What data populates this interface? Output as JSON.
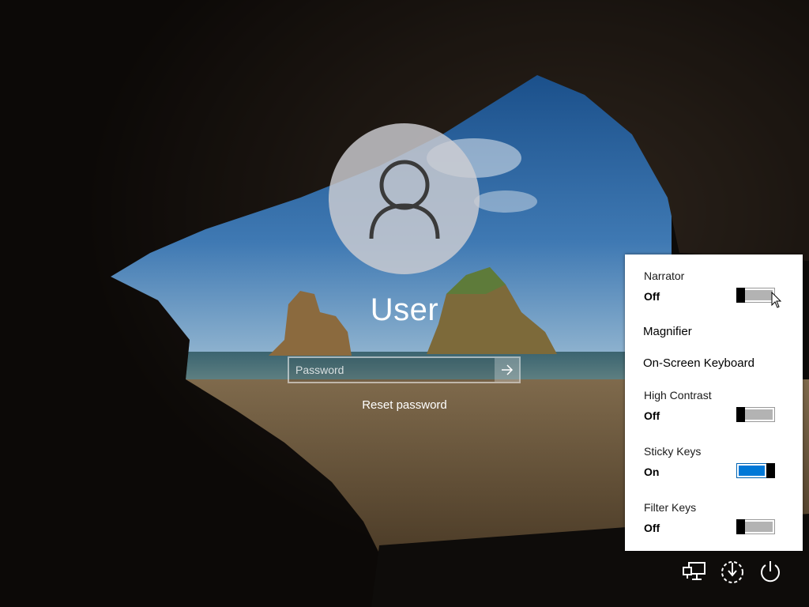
{
  "user": {
    "name": "User"
  },
  "password": {
    "placeholder": "Password",
    "value": ""
  },
  "reset_link": "Reset password",
  "ease_of_access": {
    "narrator": {
      "label": "Narrator",
      "state": "Off",
      "on": false
    },
    "magnifier": {
      "label": "Magnifier"
    },
    "onscreen_keyboard": {
      "label": "On-Screen Keyboard"
    },
    "high_contrast": {
      "label": "High Contrast",
      "state": "Off",
      "on": false
    },
    "sticky_keys": {
      "label": "Sticky Keys",
      "state": "On",
      "on": true
    },
    "filter_keys": {
      "label": "Filter Keys",
      "state": "Off",
      "on": false
    }
  },
  "system_icons": [
    "network-icon",
    "ease-of-access-icon",
    "power-icon"
  ],
  "colors": {
    "toggle_on": "#0078d7",
    "toggle_off": "#b3b3b3",
    "panel_bg": "#ffffff"
  }
}
